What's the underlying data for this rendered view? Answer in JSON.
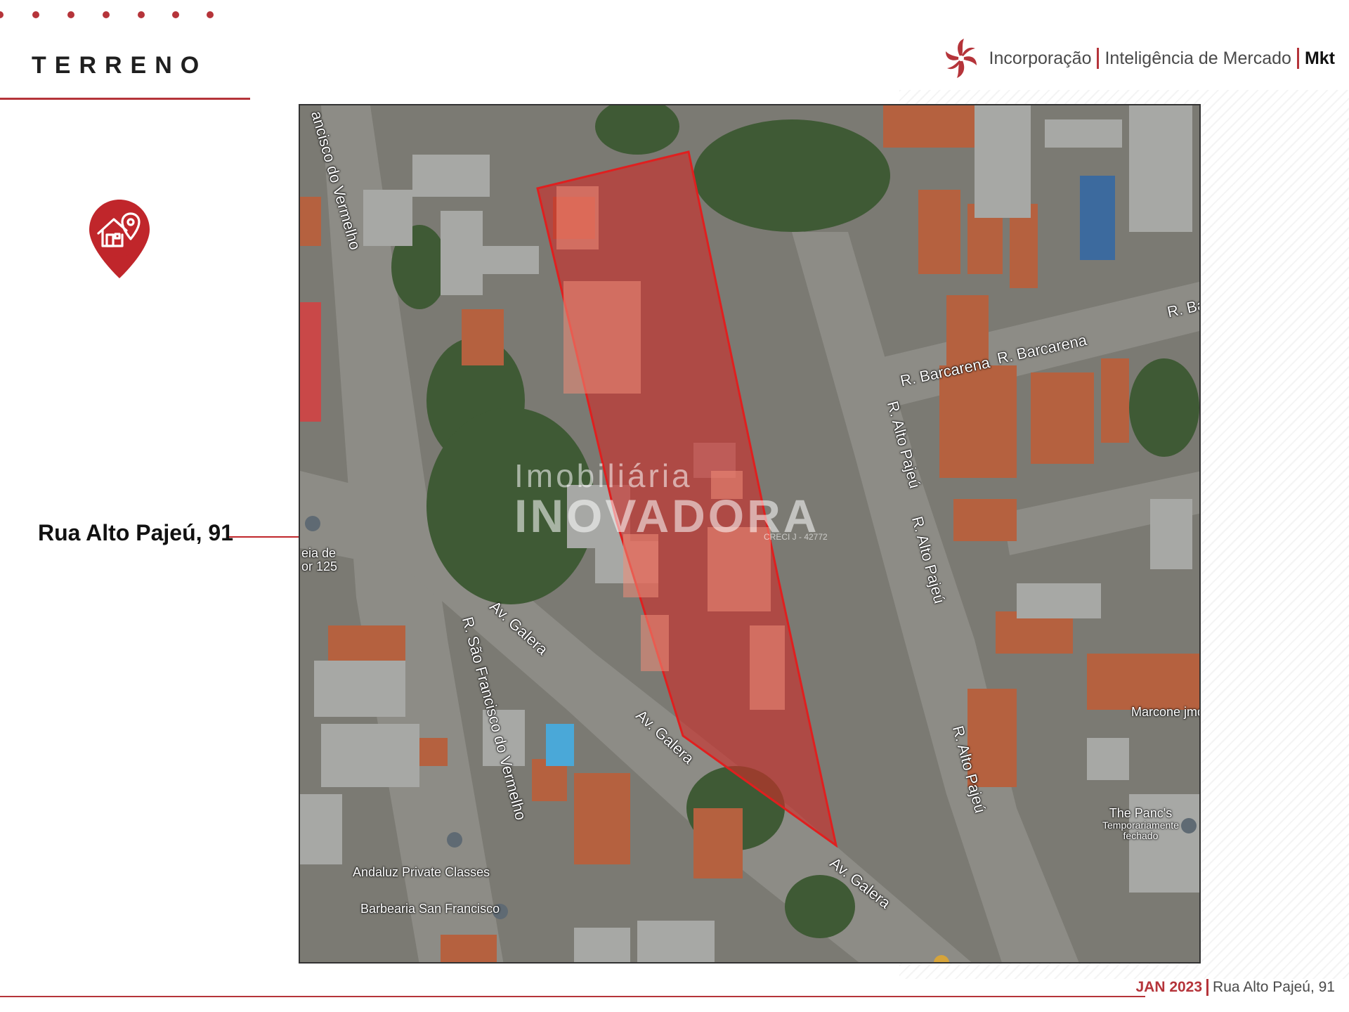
{
  "header": {
    "section_title": "TERRENO",
    "brand": {
      "part1": "Incorporação",
      "part2": "Inteligência de Mercado",
      "part3": "Mkt"
    }
  },
  "property": {
    "address_label": "Rua Alto Pajeú, 91"
  },
  "map": {
    "streets": {
      "sao_francisco_top": "ancisco do Vermelho",
      "barcarena_1": "R. Barcarena",
      "barcarena_2": "R. Barcarena",
      "barcarena_3": "R. Ba",
      "alto_pajeu_1": "R. Alto Pajeú",
      "alto_pajeu_2": "R. Alto Pajeú",
      "alto_pajeu_3": "R. Alto Pajeú",
      "galera_1": "Av. Galera",
      "galera_2": "Av. Galera",
      "galera_3": "Av. Galera",
      "sao_francisco_bottom": "R. São Francisco do Vermelho"
    },
    "pois": {
      "igreja_line1": "eia de",
      "igreja_line2": "or 125",
      "marcone": "Marcone jmd",
      "panc_line1": "The Panc's",
      "panc_line2": "Temporariamente",
      "panc_line3": "fechado",
      "andaluz": "Andaluz Private Classes",
      "barbearia": "Barbearia San Francisco"
    },
    "watermark": {
      "line1": "Imobiliária",
      "line2": "INOVADORA",
      "creci": "CRECI J - 42772"
    },
    "highlight_color": "#d0262b"
  },
  "footer": {
    "date": "JAN 2023",
    "address": "Rua Alto Pajeú, 91"
  },
  "colors": {
    "accent": "#b5343a",
    "text_dark": "#1f1f1f",
    "text_grey": "#4a4a4a"
  },
  "icons": {
    "brand_logo": "pinwheel-logo-icon",
    "location": "house-location-pin-icon",
    "map_markers": "map-pin-icon"
  }
}
